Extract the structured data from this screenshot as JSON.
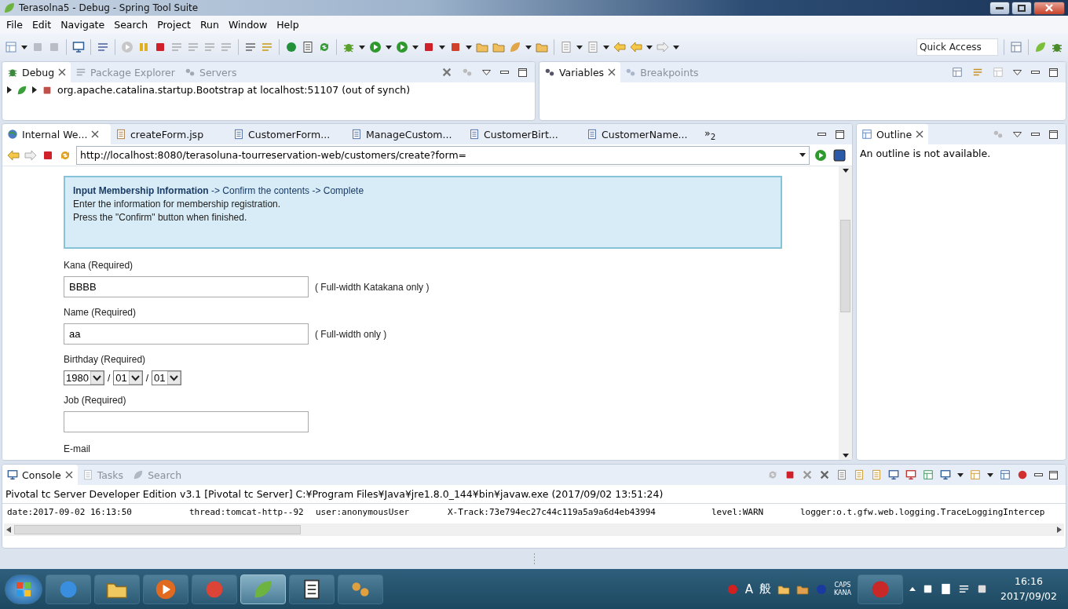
{
  "window": {
    "title": "Terasolna5 - Debug - Spring Tool Suite"
  },
  "menu": [
    "File",
    "Edit",
    "Navigate",
    "Search",
    "Project",
    "Run",
    "Window",
    "Help"
  ],
  "quick_access": {
    "placeholder": "Quick Access"
  },
  "debug_panel": {
    "tabs": [
      {
        "label": "Debug",
        "selected": true
      },
      {
        "label": "Package Explorer",
        "selected": false
      },
      {
        "label": "Servers",
        "selected": false
      }
    ],
    "launch": "org.apache.catalina.startup.Bootstrap at localhost:51107 (out of synch)"
  },
  "variables_panel": {
    "tabs": [
      {
        "label": "Variables",
        "selected": true
      },
      {
        "label": "Breakpoints",
        "selected": false
      }
    ]
  },
  "editor": {
    "tabs": [
      {
        "label": "Internal We...",
        "kind": "web",
        "selected": true
      },
      {
        "label": "createForm.jsp",
        "kind": "jsp",
        "selected": false
      },
      {
        "label": "CustomerForm...",
        "kind": "java",
        "selected": false
      },
      {
        "label": "ManageCustom...",
        "kind": "java",
        "selected": false
      },
      {
        "label": "CustomerBirt...",
        "kind": "java",
        "selected": false
      },
      {
        "label": "CustomerName...",
        "kind": "java",
        "selected": false
      }
    ],
    "overflow": "»$_{2}$",
    "url": "http://localhost:8080/terasoluna-tourreservation-web/customers/create?form=",
    "page": {
      "steps": "**Input Membership Information** -> Confirm the contents -> Complete",
      "notes": [
        "Enter the information for membership registration.",
        "Press the \"Confirm\" button when finished."
      ],
      "fields": [
        {
          "label": "Kana (Required)",
          "kind": "text",
          "value": "BBBB",
          "hint": "( Full-width Katakana only )"
        },
        {
          "label": "Name (Required)",
          "kind": "text",
          "value": "aa",
          "hint": "( Full-width only )"
        },
        {
          "label": "Birthday (Required)",
          "kind": "date",
          "parts": [
            "1980",
            "01",
            "01"
          ],
          "separator": "/"
        },
        {
          "label": "Job (Required)",
          "kind": "text"
        },
        {
          "label": "E-mail",
          "kind": "label"
        }
      ]
    }
  },
  "outline": {
    "tab": "Outline",
    "message": "An outline is not available."
  },
  "console": {
    "tabs": [
      {
        "label": "Console",
        "selected": true
      },
      {
        "label": "Tasks",
        "selected": false
      },
      {
        "label": "Search",
        "selected": false
      }
    ],
    "header": "Pivotal tc Server Developer Edition v3.1 [Pivotal tc Server] C:¥Program Files¥Java¥jre1.8.0_144¥bin¥javaw.exe (2017/09/02 13:51:24)",
    "log": [
      "date:2017-09-02 16:13:50",
      "thread:tomcat-http--92",
      "user:anonymousUser",
      "X-Track:73e794ec27c44c119a5a9a6d4eb43994",
      "level:WARN",
      "logger:o.t.gfw.web.logging.TraceLoggingIntercep"
    ]
  },
  "taskbar": {
    "ime": [
      "A",
      "般"
    ],
    "caps": "CAPS",
    "kana": "KANA",
    "time": "16:16",
    "date": "2017/09/02"
  }
}
